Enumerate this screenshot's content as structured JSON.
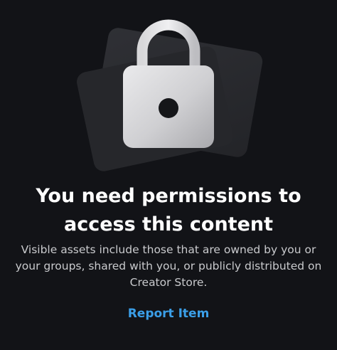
{
  "illustration": {
    "icon": "lock-icon",
    "card_color": "#2c2d32",
    "lock_color": "#d6d6d8"
  },
  "message": {
    "title": "You need permissions to access this content",
    "description": "Visible assets include those that are owned by you or your groups, shared with you, or publicly distributed on Creator Store."
  },
  "actions": {
    "report_label": "Report Item",
    "link_color": "#3b9fe8"
  }
}
